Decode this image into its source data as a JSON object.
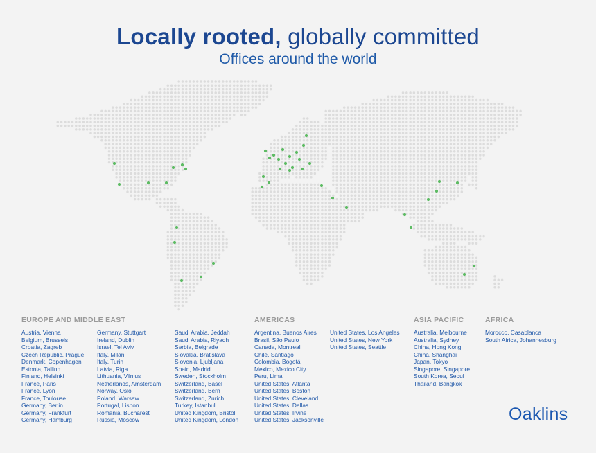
{
  "header": {
    "title_bold": "Locally rooted,",
    "title_rest": " globally committed",
    "subtitle": "Offices around the world"
  },
  "colors": {
    "dot": "#dcdcdc",
    "office": "#5dbb63",
    "text": "#1f57a8",
    "heading": "#9a9a9a"
  },
  "regions": {
    "europe": {
      "heading": "EUROPE AND MIDDLE EAST",
      "col1": [
        "Austria, Vienna",
        "Belgium, Brussels",
        "Croatia, Zagreb",
        "Czech Republic, Prague",
        "Denmark, Copenhagen",
        "Estonia, Tallinn",
        "Finland, Helsinki",
        "France, Paris",
        "France, Lyon",
        "France, Toulouse",
        "Germany, Berlin",
        "Germany, Frankfurt",
        "Germany, Hamburg"
      ],
      "col2": [
        "Germany, Stuttgart",
        "Ireland, Dublin",
        "Israel, Tel Aviv",
        "Italy, Milan",
        "Italy, Turin",
        "Latvia, Riga",
        "Lithuania, Vilnius",
        "Netherlands, Amsterdam",
        "Norway, Oslo",
        "Poland, Warsaw",
        "Portugal, Lisbon",
        "Romania, Bucharest",
        "Russia, Moscow"
      ],
      "col3": [
        "Saudi Arabia, Jeddah",
        "Saudi Arabia, Riyadh",
        "Serbia, Belgrade",
        "Slovakia, Bratislava",
        "Slovenia, Ljubljana",
        "Spain, Madrid",
        "Sweden, Stockholm",
        "Switzerland, Basel",
        "Switzerland, Bern",
        "Switzerland, Zurich",
        "Turkey, Istanbul",
        "United Kingdom, Bristol",
        "United Kingdom, London"
      ]
    },
    "americas": {
      "heading": "AMERICAS",
      "col1": [
        "Argentina, Buenos Aires",
        "Brasil, São Paulo",
        "Canada, Montreal",
        "Chile, Santiago",
        "Colombia, Bogotá",
        "Mexico, Mexico City",
        "Peru, Lima",
        "United States, Atlanta",
        "United States, Boston",
        "United States, Cleveland",
        "United States, Dallas",
        "United States, Irvine",
        "United States, Jacksonville"
      ],
      "col2": [
        "United States, Los Angeles",
        "United States, New York",
        "United States, Seattle"
      ]
    },
    "asia": {
      "heading": "ASIA PACIFIC",
      "col1": [
        "Australia, Melbourne",
        "Australia, Sydney",
        "China, Hong Kong",
        "China, Shanghai",
        "Japan, Tokyo",
        "Singapore, Singapore",
        "South Korea, Seoul",
        "Thailand, Bangkok"
      ]
    },
    "africa": {
      "heading": "AFRICA",
      "col1": [
        "Morocco, Casablanca",
        "South Africa, Johannesburg"
      ]
    }
  },
  "logo": "Oaklins"
}
